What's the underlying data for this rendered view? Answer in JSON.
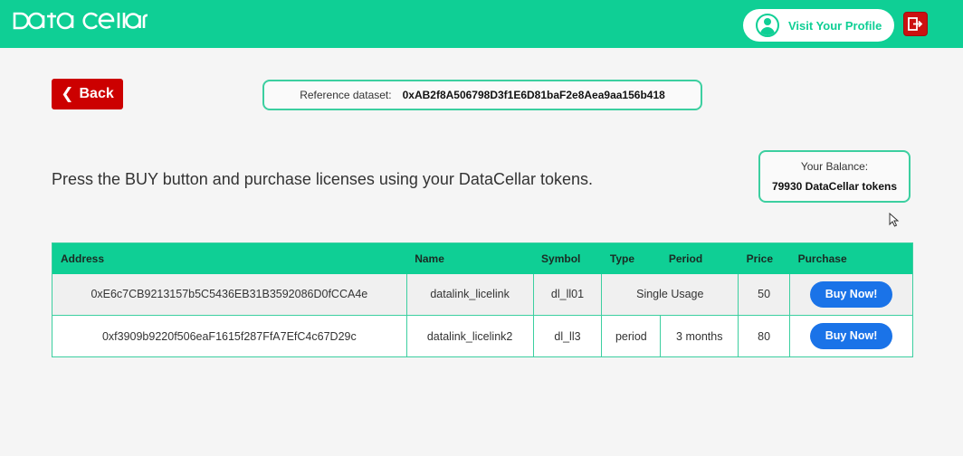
{
  "header": {
    "logo": "DATA CELLAR",
    "profile_label": "Visit Your Profile"
  },
  "nav": {
    "back_label": "Back"
  },
  "reference": {
    "label": "Reference dataset:",
    "address": "0xAB2f8A506798D3f1E6D81baF2e8Aea9aa156b418"
  },
  "instruction": "Press the BUY button and purchase licenses using your DataCellar tokens.",
  "balance": {
    "label": "Your Balance:",
    "value": "79930 DataCellar tokens"
  },
  "table": {
    "headers": [
      "Address",
      "Name",
      "Symbol",
      "Type",
      "Period",
      "Price",
      "Purchase"
    ],
    "rows": [
      {
        "address": "0xE6c7CB9213157b5C5436EB31B3592086D0fCCA4e",
        "name": "datalink_licelink",
        "symbol": "dl_ll01",
        "type": "Single Usage",
        "period": "",
        "price": "50",
        "action": "Buy Now!"
      },
      {
        "address": "0xf3909b9220f506eaF1615f287FfA7EfC4c67D29c",
        "name": "datalink_licelink2",
        "symbol": "dl_ll3",
        "type": "period",
        "period": "3 months",
        "price": "80",
        "action": "Buy Now!"
      }
    ]
  },
  "colors": {
    "accent": "#0fcf95",
    "danger": "#cc0000",
    "primary_button": "#1a73e8"
  }
}
